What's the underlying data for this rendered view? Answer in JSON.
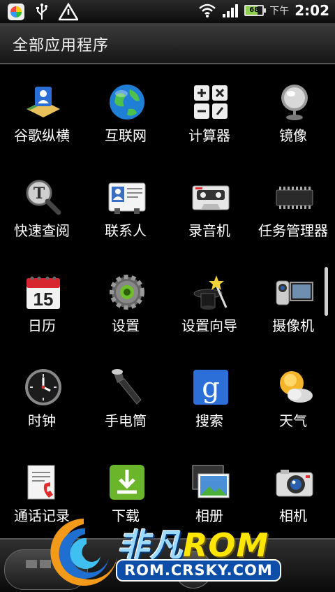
{
  "status_bar": {
    "ampm": "下午",
    "time": "2:02",
    "battery_level": "68",
    "icons": [
      "color-wheel-icon",
      "usb-icon",
      "warning-icon",
      "wifi-icon",
      "signal-icon",
      "battery-icon"
    ]
  },
  "header": {
    "title": "全部应用程序"
  },
  "apps": [
    {
      "label": "谷歌纵横",
      "icon": "latitude-icon"
    },
    {
      "label": "互联网",
      "icon": "globe-icon"
    },
    {
      "label": "计算器",
      "icon": "calculator-icon"
    },
    {
      "label": "镜像",
      "icon": "mirror-icon"
    },
    {
      "label": "快速查阅",
      "icon": "magnifier-icon"
    },
    {
      "label": "联系人",
      "icon": "contacts-icon"
    },
    {
      "label": "录音机",
      "icon": "cassette-icon"
    },
    {
      "label": "任务管理器",
      "icon": "chip-icon"
    },
    {
      "label": "日历",
      "icon": "calendar-icon"
    },
    {
      "label": "设置",
      "icon": "gear-icon"
    },
    {
      "label": "设置向导",
      "icon": "magic-hat-icon"
    },
    {
      "label": "摄像机",
      "icon": "camcorder-icon"
    },
    {
      "label": "时钟",
      "icon": "clock-icon"
    },
    {
      "label": "手电筒",
      "icon": "flashlight-icon"
    },
    {
      "label": "搜索",
      "icon": "google-search-icon"
    },
    {
      "label": "天气",
      "icon": "weather-icon"
    },
    {
      "label": "通话记录",
      "icon": "call-log-icon"
    },
    {
      "label": "下载",
      "icon": "download-icon"
    },
    {
      "label": "相册",
      "icon": "gallery-icon"
    },
    {
      "label": "相机",
      "icon": "camera-icon"
    }
  ],
  "calendar_day": "15",
  "watermark": {
    "title_cn": "非凡",
    "title_rom": "ROM",
    "url": "ROM.CRSKY.COM"
  }
}
